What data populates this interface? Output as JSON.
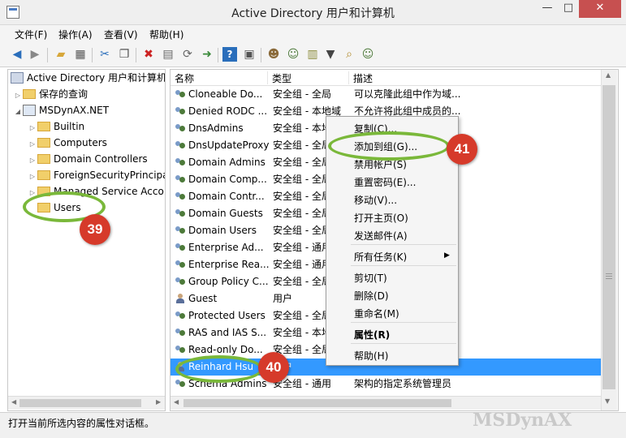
{
  "window": {
    "title": "Active Directory 用户和计算机",
    "minimize": "—",
    "maximize": "□",
    "close": "✕"
  },
  "menu": [
    "文件(F)",
    "操作(A)",
    "查看(V)",
    "帮助(H)"
  ],
  "toolbar_icons": [
    "back-arrow-icon",
    "forward-arrow-icon",
    "up-folder-icon",
    "show-tree-icon",
    "cut-icon",
    "copy-icon",
    "delete-icon",
    "properties-icon",
    "refresh-icon",
    "export-icon",
    "help-icon",
    "console-icon",
    "new-user-icon",
    "new-group-icon",
    "new-ou-icon",
    "filter-icon",
    "find-icon",
    "add-to-group-icon"
  ],
  "tree": {
    "root": "Active Directory 用户和计算机",
    "saved_queries": "保存的查询",
    "domain": "MSDynAX.NET",
    "items": [
      "Builtin",
      "Computers",
      "Domain Controllers",
      "ForeignSecurityPrincipa",
      "Managed Service Acco",
      "Users"
    ]
  },
  "list": {
    "columns": [
      "名称",
      "类型",
      "描述"
    ],
    "rows": [
      {
        "name": "Cloneable Do...",
        "type": "安全组 - 全局",
        "desc": "可以克隆此组中作为域...",
        "icon": "group"
      },
      {
        "name": "Denied RODC ...",
        "type": "安全组 - 本地域",
        "desc": "不允许将此组中成员的...",
        "icon": "group"
      },
      {
        "name": "DnsAdmins",
        "type": "安全组 - 本地",
        "desc": "",
        "icon": "group"
      },
      {
        "name": "DnsUpdateProxy",
        "type": "安全组 - 全局",
        "desc": "",
        "icon": "group"
      },
      {
        "name": "Domain Admins",
        "type": "安全组 - 全局",
        "desc": "",
        "icon": "group"
      },
      {
        "name": "Domain Comp...",
        "type": "安全组 - 全局",
        "desc": "",
        "icon": "group"
      },
      {
        "name": "Domain Contr...",
        "type": "安全组 - 全局",
        "desc": "",
        "icon": "group"
      },
      {
        "name": "Domain Guests",
        "type": "安全组 - 全局",
        "desc": "",
        "icon": "group"
      },
      {
        "name": "Domain Users",
        "type": "安全组 - 全局",
        "desc": "",
        "icon": "group"
      },
      {
        "name": "Enterprise Ad...",
        "type": "安全组 - 通用",
        "desc": "",
        "icon": "group"
      },
      {
        "name": "Enterprise Rea...",
        "type": "安全组 - 通用",
        "desc": "",
        "icon": "group"
      },
      {
        "name": "Group Policy C...",
        "type": "安全组 - 全局",
        "desc": "",
        "icon": "group"
      },
      {
        "name": "Guest",
        "type": "用户",
        "desc": "",
        "icon": "user"
      },
      {
        "name": "Protected Users",
        "type": "安全组 - 全局",
        "desc": "",
        "icon": "group"
      },
      {
        "name": "RAS and IAS S...",
        "type": "安全组 - 本地",
        "desc": "",
        "icon": "group"
      },
      {
        "name": "Read-only Do...",
        "type": "安全组 - 全局",
        "desc": "",
        "icon": "group"
      },
      {
        "name": "Reinhard Hsu",
        "type": "用户",
        "desc": "",
        "icon": "user",
        "selected": true
      },
      {
        "name": "Schema Admins",
        "type": "安全组 - 通用",
        "desc": "架构的指定系统管理员",
        "icon": "group"
      }
    ]
  },
  "context_menu": {
    "items": [
      "复制(C)...",
      "添加到组(G)...",
      "禁用帐户(S)",
      "重置密码(E)...",
      "移动(V)...",
      "打开主页(O)",
      "发送邮件(A)",
      "所有任务(K)",
      "剪切(T)",
      "删除(D)",
      "重命名(M)",
      "属性(R)",
      "帮助(H)"
    ],
    "submenu_arrow": "▶"
  },
  "annotations": {
    "badge_users": "39",
    "badge_user": "40",
    "badge_add_to_group": "41",
    "ring_color": "#7ab83a",
    "badge_color": "#d63a2a"
  },
  "status": {
    "text": "打开当前所选内容的属性对话框。",
    "watermark": "MSDynAX"
  },
  "colors": {
    "selection": "#3399ff",
    "folder": "#f1cf6a"
  }
}
